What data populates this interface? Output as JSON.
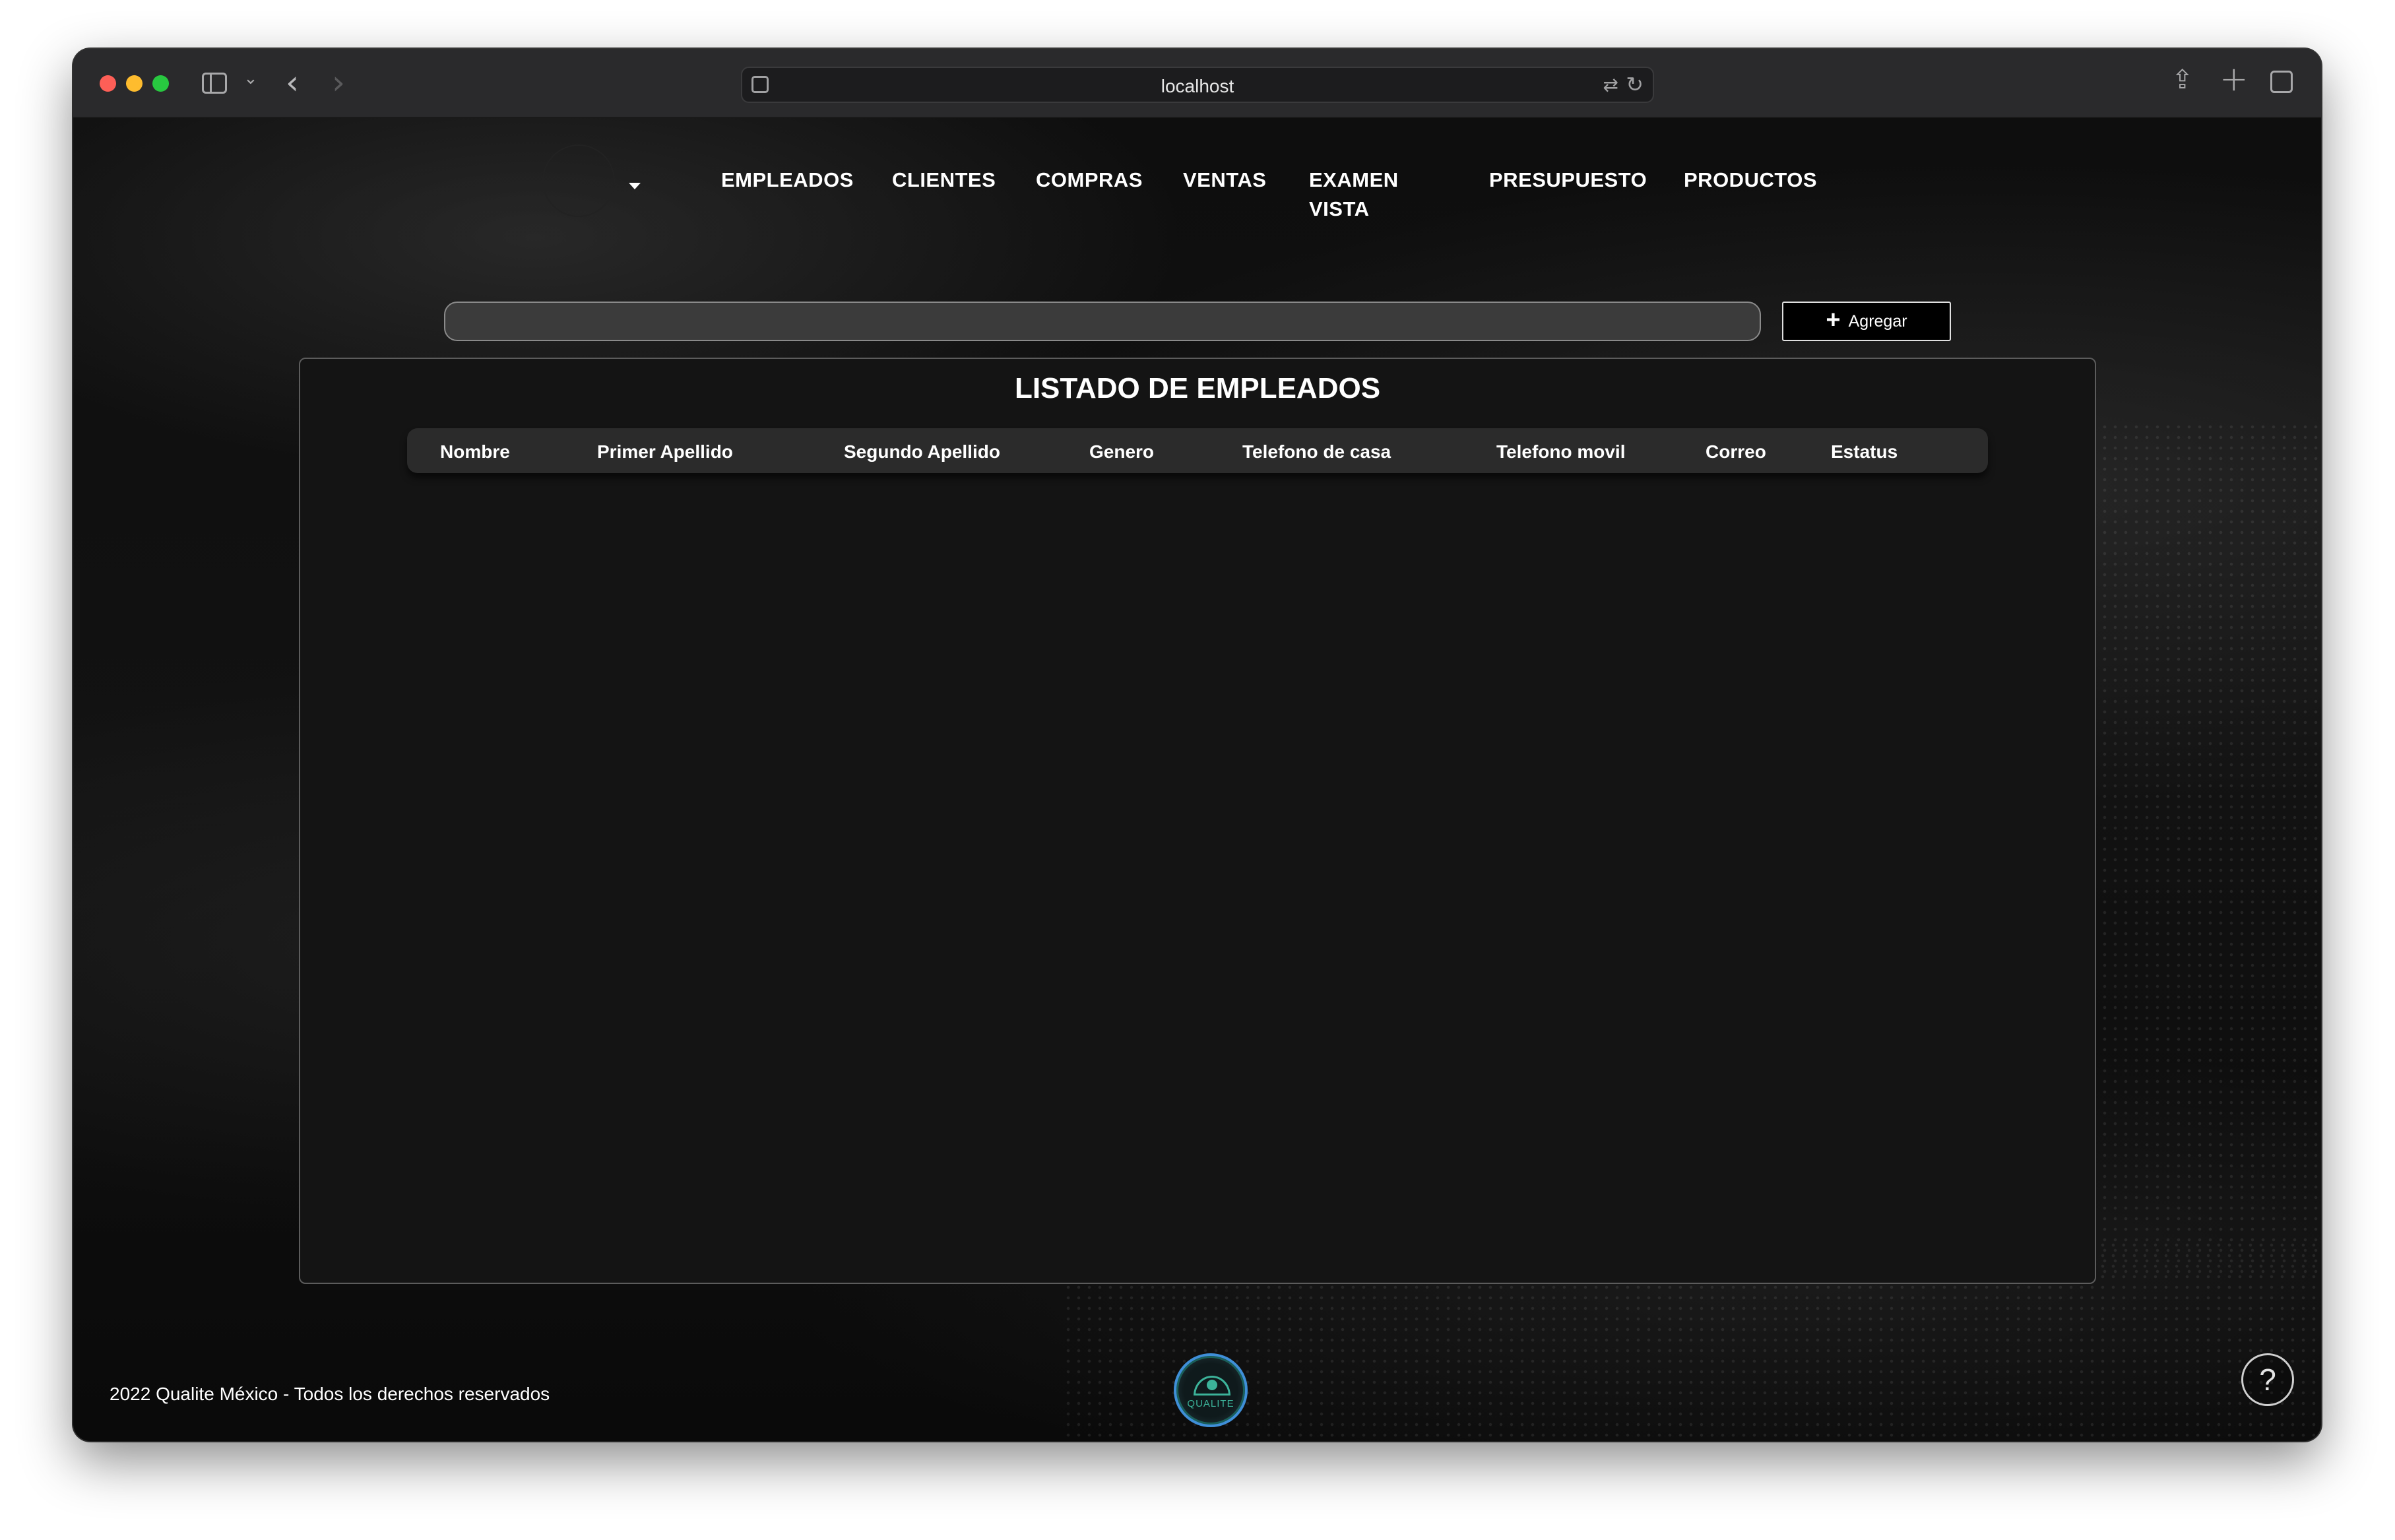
{
  "browser": {
    "url": "localhost",
    "icons": [
      "sidebar-toggle-icon",
      "chevron-down-icon",
      "back-icon",
      "forward-icon",
      "site-icon",
      "translate-icon",
      "reload-icon",
      "share-icon",
      "new-tab-icon",
      "tabs-overview-icon"
    ]
  },
  "nav": {
    "items": [
      {
        "label": "EMPLEADOS"
      },
      {
        "label": "CLIENTES"
      },
      {
        "label": "COMPRAS"
      },
      {
        "label": "VENTAS"
      },
      {
        "label": "EXAMEN VISTA"
      },
      {
        "label": "PRESUPUESTO"
      },
      {
        "label": "PRODUCTOS"
      }
    ]
  },
  "toolbar": {
    "search_value": "",
    "add_label": "Agregar"
  },
  "table": {
    "title": "LISTADO DE EMPLEADOS",
    "columns": [
      "Nombre",
      "Primer Apellido",
      "Segundo Apellido",
      "Genero",
      "Telefono de casa",
      "Telefono movil",
      "Correo",
      "Estatus"
    ],
    "rows": []
  },
  "footer": {
    "copyright": "2022 Qualite México - Todos los derechos reservados",
    "logo_text": "QUALITE",
    "help_label": "?"
  },
  "colors": {
    "page_background": "#0e0e0e",
    "card_background": "#141414",
    "header_background": "#2b2b2b",
    "logo_accent": "#3cb39a"
  }
}
